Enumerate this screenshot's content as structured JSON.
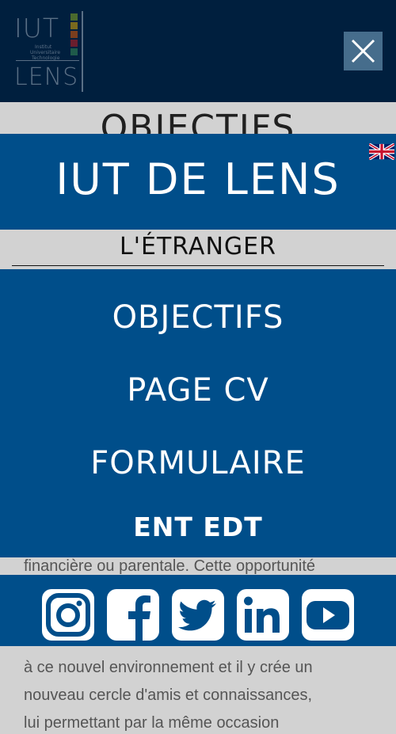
{
  "header": {
    "logo_line1": "IUT",
    "logo_line2": "LENS",
    "logo_sub1": "Institut",
    "logo_sub2": "Universitaire",
    "logo_sub3": "Technologie"
  },
  "background": {
    "page_title": "OBJECTIFS",
    "text_lines": [
      "financière ou parentale. Cette opportunité",
      "à ce nouvel environnement et il y crée un",
      "nouveau cercle d'amis et connaissances,",
      "lui permettant par la même occasion"
    ]
  },
  "menu": {
    "site_title": "IUT DE LENS",
    "section_label": "L'ÉTRANGER",
    "items": [
      {
        "label": "OBJECTIFS"
      },
      {
        "label": "PAGE CV"
      },
      {
        "label": "FORMULAIRE"
      },
      {
        "label": "ENT  EDT"
      }
    ],
    "social": [
      "instagram-icon",
      "facebook-icon",
      "twitter-icon",
      "linkedin-icon",
      "youtube-icon"
    ]
  },
  "colors": {
    "header": "#001f3e",
    "menu_band": "#004e8a",
    "close_button": "#466d8c",
    "page_bg": "#d2d2d2"
  }
}
